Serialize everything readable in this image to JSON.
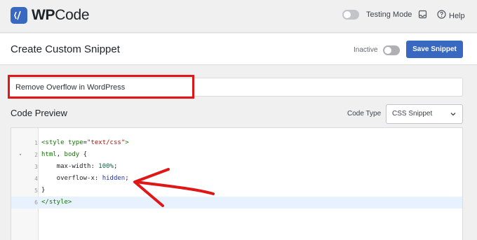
{
  "brand": {
    "name_prefix": "WP",
    "name_suffix": "Code",
    "accent": "#3968c0"
  },
  "topbar": {
    "testing_mode_label": "Testing Mode",
    "help_label": "Help"
  },
  "header": {
    "title": "Create Custom Snippet",
    "status_label": "Inactive",
    "save_label": "Save Snippet"
  },
  "snippet": {
    "title_value": "Remove Overflow in WordPress"
  },
  "code_preview": {
    "heading": "Code Preview",
    "code_type_label": "Code Type",
    "code_type_value": "CSS Snippet",
    "lines": [
      {
        "number": "1",
        "text": "<style type=\"text/css\">"
      },
      {
        "number": "2",
        "text": "html, body {"
      },
      {
        "number": "3",
        "text": "    max-width: 100%;"
      },
      {
        "number": "4",
        "text": "    overflow-x: hidden;"
      },
      {
        "number": "5",
        "text": "}"
      },
      {
        "number": "6",
        "text": "</style>"
      }
    ]
  },
  "colors": {
    "highlight": "#e01717",
    "arrow": "#e01717"
  },
  "icons": [
    "wpcode-logo-icon",
    "notification-icon",
    "help-icon",
    "chevron-down-icon",
    "fold-arrow-icon"
  ]
}
